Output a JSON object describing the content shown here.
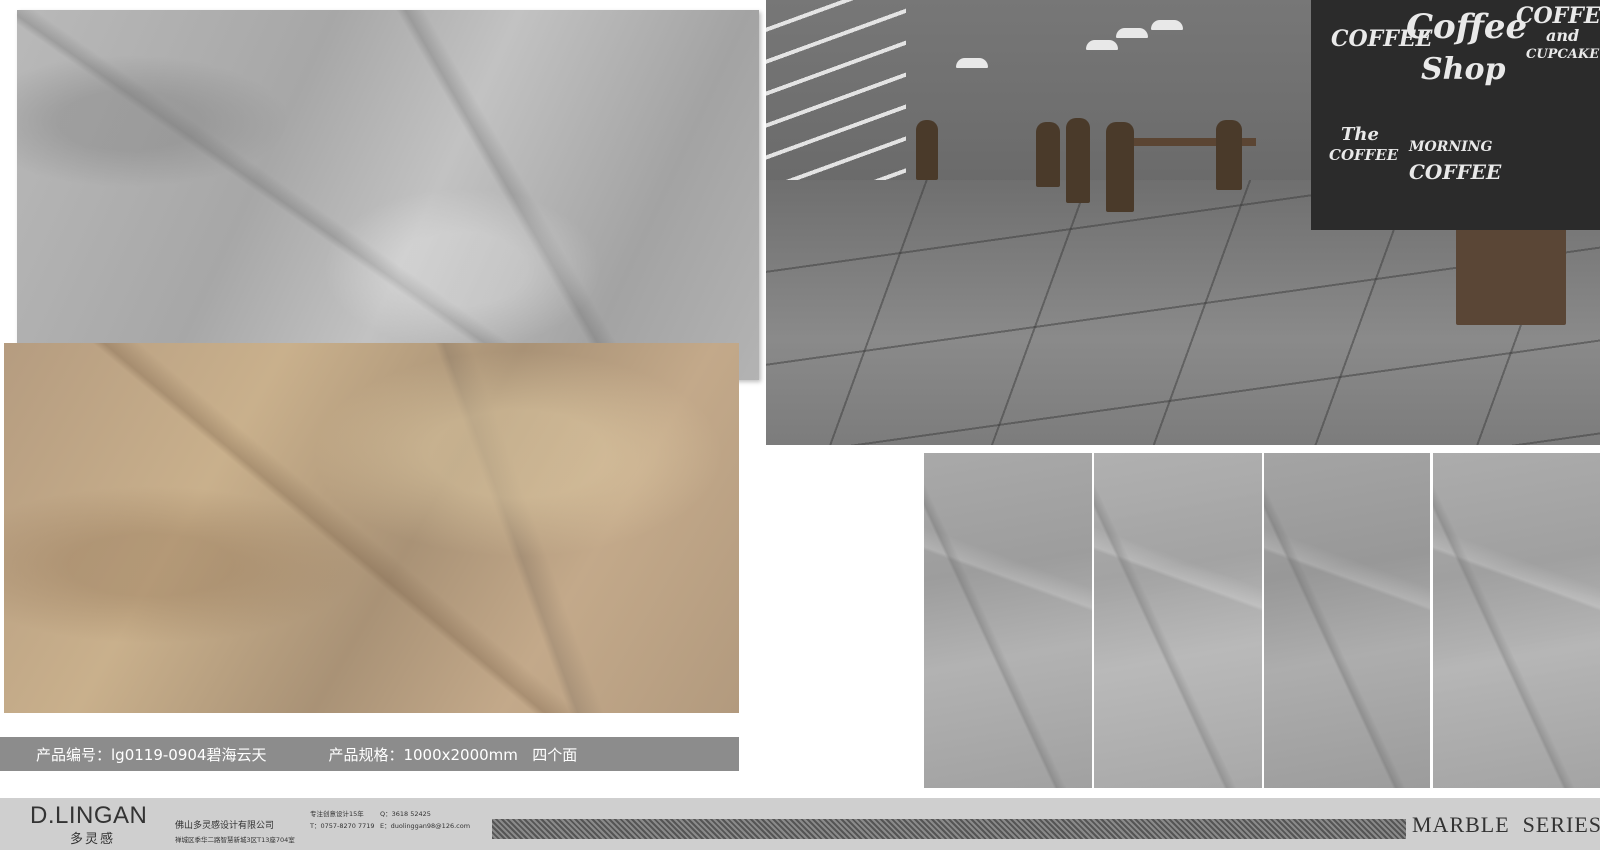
{
  "product": {
    "code_text": "产品编号：lg0119-0904碧海云天",
    "spec_text": "产品规格：1000x2000mm   四个面"
  },
  "scene": {
    "chalkboard": {
      "line1": "COFFEE",
      "line2": "Coffee",
      "line3": "Shop",
      "line4": "COFFEE",
      "line5": "and",
      "line6": "CUPCAKE",
      "line7": "The",
      "line8": "COFFEE",
      "line9": "MORNING",
      "line10": "COFFEE"
    }
  },
  "footer": {
    "brand": "D.LINGAN",
    "brand_cn": "多灵感",
    "company": "佛山多灵感设计有限公司",
    "address": "禅城区季华二路智慧新城3区T13座704室",
    "tagline": "专注创意设计15年",
    "qq": "Q：3618 52425",
    "phone": "T：0757-8270 7719",
    "email": "E：duolinggan98@126.com",
    "series": "MARBLE  SERIES"
  }
}
